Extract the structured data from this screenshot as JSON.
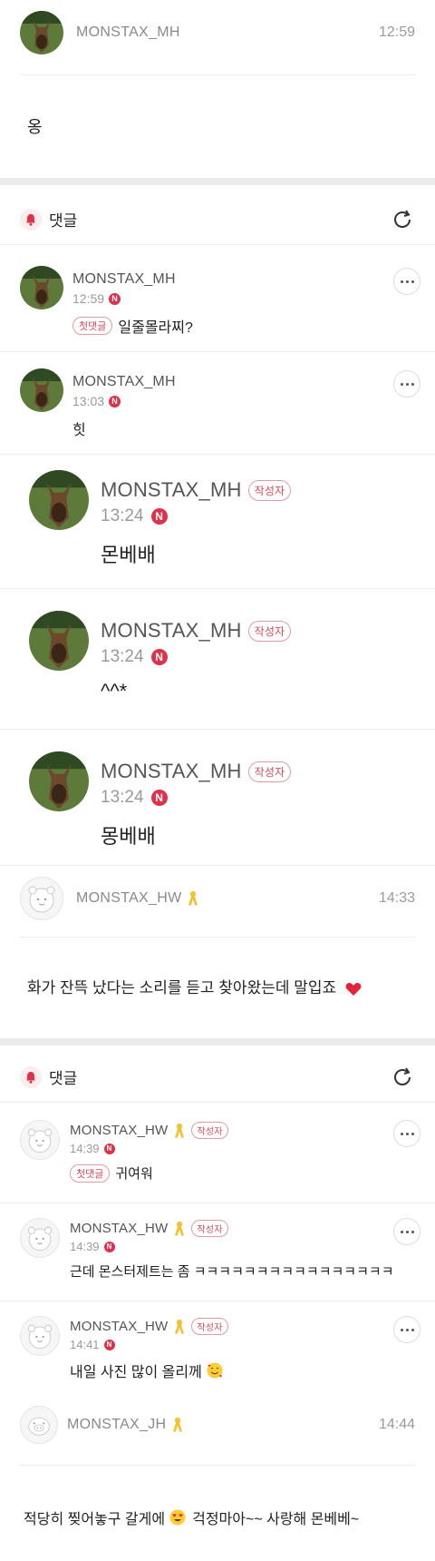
{
  "post1": {
    "author": "MONSTAX_MH",
    "time": "12:59",
    "body": "옹"
  },
  "comments_bar": {
    "label": "댓글"
  },
  "comments1": [
    {
      "author": "MONSTAX_MH",
      "time": "12:59",
      "badge": "N",
      "reply_tag": "첫댓글",
      "text": "일줄몰라찌?"
    },
    {
      "author": "MONSTAX_MH",
      "time": "13:03",
      "badge": "N",
      "text": "힛"
    },
    {
      "author": "MONSTAX_MH",
      "tag": "작성자",
      "time": "13:24",
      "badge": "N",
      "text": "몬베배"
    },
    {
      "author": "MONSTAX_MH",
      "tag": "작성자",
      "time": "13:24",
      "badge": "N",
      "text": "^^*"
    },
    {
      "author": "MONSTAX_MH",
      "tag": "작성자",
      "time": "13:24",
      "badge": "N",
      "text": "몽베배"
    }
  ],
  "post2": {
    "author": "MONSTAX_HW",
    "time": "14:33",
    "body": "화가 잔뜩 났다는 소리를 듣고 찾아왔는데 말입죠"
  },
  "comments2": [
    {
      "author": "MONSTAX_HW",
      "tag": "작성자",
      "time": "14:39",
      "badge": "N",
      "reply_tag": "첫댓글",
      "text": "귀여워"
    },
    {
      "author": "MONSTAX_HW",
      "tag": "작성자",
      "time": "14:39",
      "badge": "N",
      "text": "근데 몬스터제트는 좀 ㅋㅋㅋㅋㅋㅋㅋㅋㅋㅋㅋㅋㅋㅋㅋㅋ"
    },
    {
      "author": "MONSTAX_HW",
      "tag": "작성자",
      "time": "14:41",
      "badge": "N",
      "text": "내일 사진 많이 올리께"
    }
  ],
  "post3": {
    "author": "MONSTAX_JH",
    "time": "14:44",
    "body_a": "적당히 찢어놓구 갈게에",
    "body_b": "걱정마아~~ 사랑해 몬베베~"
  },
  "colors": {
    "accent": "#e0314b",
    "tag_border": "#e39aa3",
    "divider": "#ececec",
    "band": "#ebebeb"
  },
  "icons": [
    "bell-icon",
    "refresh-icon",
    "more-icon",
    "yellow-ribbon-icon",
    "heart-emoji",
    "smiling-hearts-emoji",
    "heart-eyes-emoji"
  ]
}
